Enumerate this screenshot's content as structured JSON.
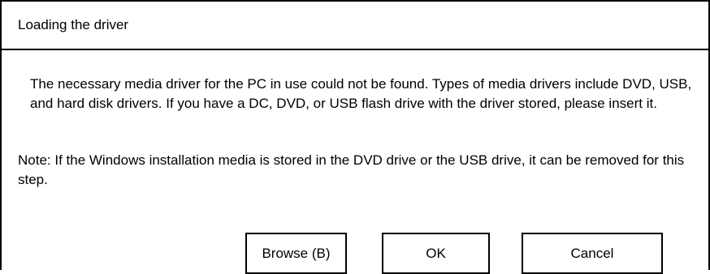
{
  "dialog": {
    "title": "Loading the driver",
    "message": "The necessary media driver for the PC in use could not be found. Types of media drivers include DVD, USB, and hard disk drivers. If you have a DC, DVD, or USB flash drive with the driver stored, please insert it.",
    "note": "Note: If the Windows installation media is stored in the DVD drive or the USB drive, it can be removed for this step."
  },
  "buttons": {
    "browse_label": "Browse (B)",
    "ok_label": "OK",
    "cancel_label": "Cancel"
  }
}
